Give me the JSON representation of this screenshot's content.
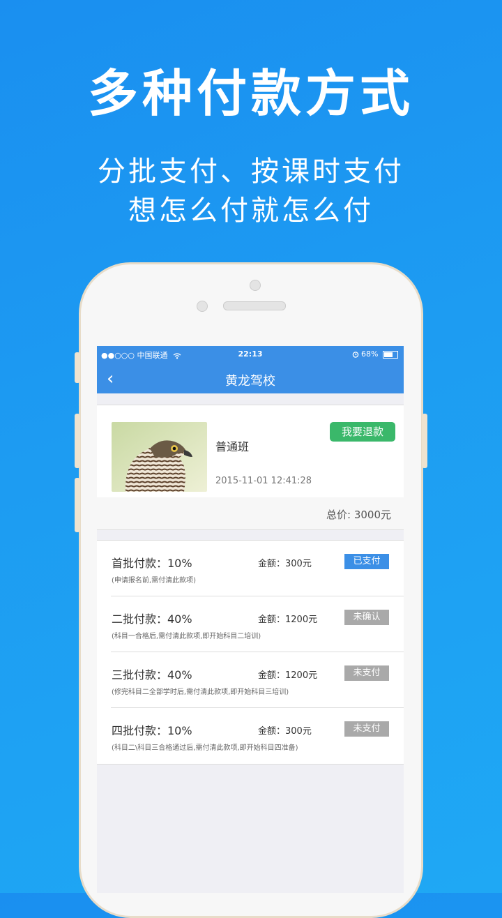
{
  "promo": {
    "headline": "多种付款方式",
    "subline1": "分批支付、按课时支付",
    "subline2": "想怎么付就怎么付"
  },
  "status_bar": {
    "carrier": "●●○○○ 中国联通",
    "time": "22:13",
    "battery": "68%"
  },
  "nav": {
    "back_icon": "‹",
    "title": "黄龙驾校"
  },
  "order": {
    "course_name": "普通班",
    "datetime": "2015-11-01 12:41:28",
    "refund_label": "我要退款",
    "total": "总价: 3000元"
  },
  "payments": [
    {
      "label": "首批付款：10%",
      "amount": "金额：300元",
      "note": "(申请报名前,需付清此款项)",
      "status": "已支付",
      "paid": true
    },
    {
      "label": "二批付款：40%",
      "amount": "金额：1200元",
      "note": "(科目一合格后,需付清此款项,即开始科目二培训)",
      "status": "未确认",
      "paid": false
    },
    {
      "label": "三批付款：40%",
      "amount": "金额：1200元",
      "note": "(修完科目二全部学时后,需付清此款项,即开始科目三培训)",
      "status": "未支付",
      "paid": false
    },
    {
      "label": "四批付款：10%",
      "amount": "金额：300元",
      "note": "(科目二\\科目三合格通过后,需付清此款项,即开始科目四准备)",
      "status": "未支付",
      "paid": false
    }
  ],
  "colors": {
    "accent": "#3b8fe6",
    "refund": "#3ab86a",
    "unpaid": "#a9a9a9"
  }
}
